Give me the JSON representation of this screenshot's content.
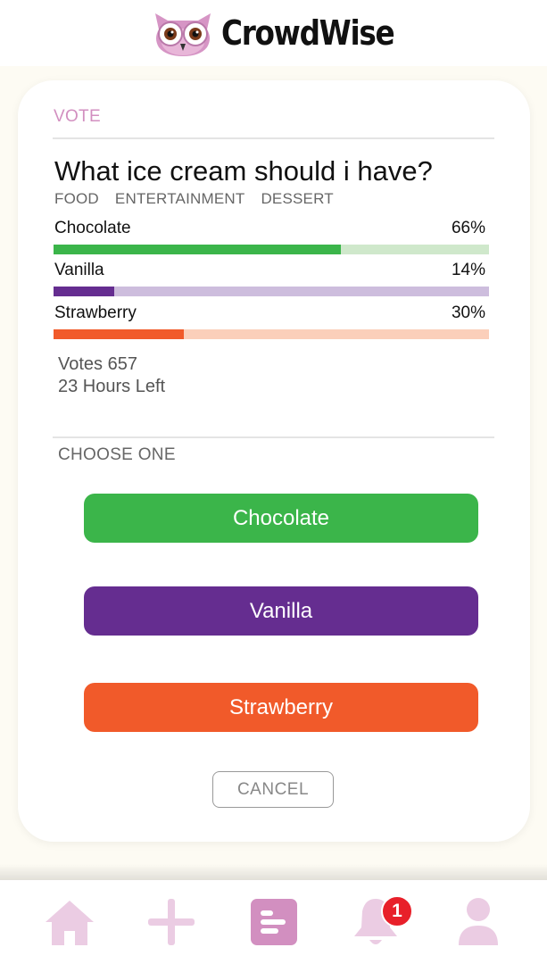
{
  "header": {
    "brand": "CrowdWise",
    "logo_icon": "owl-logo"
  },
  "poll": {
    "section_label": "VOTE",
    "question": "What ice cream should i have?",
    "tags": [
      "FOOD",
      "ENTERTAINMENT",
      "DESSERT"
    ],
    "options": [
      {
        "name": "Chocolate",
        "percent_label": "66%",
        "percent": 0.66,
        "color": "#3bb54a",
        "track_color": "#cfe8cb"
      },
      {
        "name": "Vanilla",
        "percent_label": "14%",
        "percent": 0.14,
        "color": "#652d90",
        "track_color": "#cdbddd"
      },
      {
        "name": "Strawberry",
        "percent_label": "30%",
        "percent": 0.3,
        "color": "#f15a2a",
        "track_color": "#fbcfba"
      }
    ],
    "votes": "Votes 657",
    "time_left": "23 Hours Left",
    "choose_label": "CHOOSE ONE",
    "buttons": [
      "Chocolate",
      "Vanilla",
      "Strawberry"
    ],
    "cancel_label": "CANCEL"
  },
  "nav": {
    "items": [
      "home-icon",
      "plus-icon",
      "feed-icon",
      "bell-icon",
      "user-icon"
    ],
    "active": "feed-icon",
    "notification_count": "1",
    "colors": {
      "inactive": "#ebcce3",
      "active": "#d28fc0",
      "badge": "#e8202a"
    }
  }
}
